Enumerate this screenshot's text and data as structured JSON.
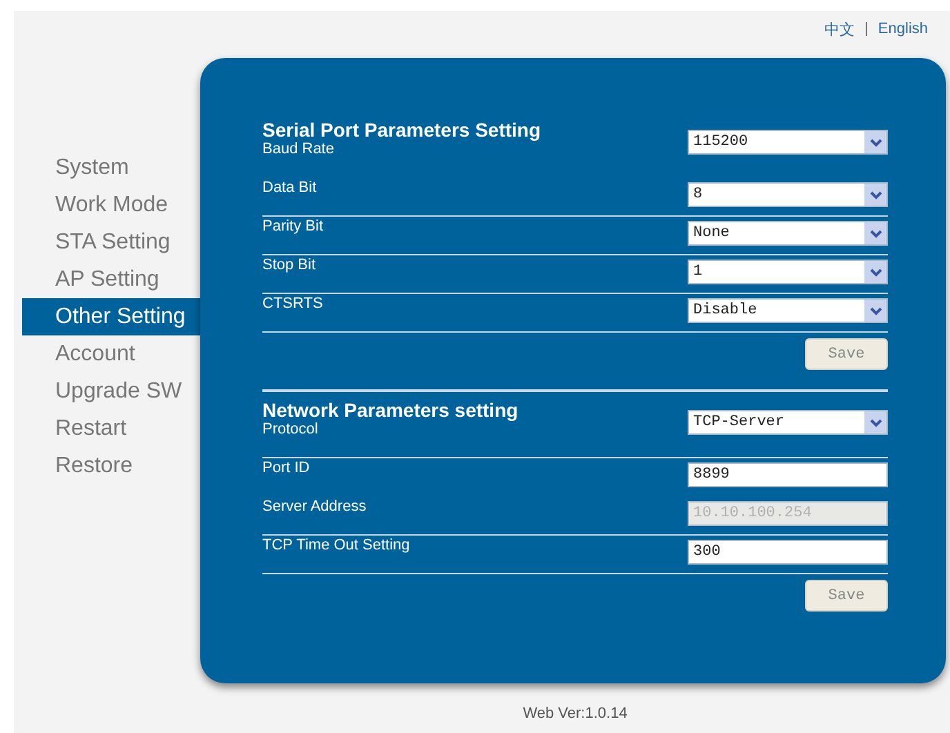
{
  "language_links": [
    "中文",
    "English"
  ],
  "sidebar": {
    "items": [
      {
        "label": "System",
        "selected": false
      },
      {
        "label": "Work Mode",
        "selected": false
      },
      {
        "label": "STA Setting",
        "selected": false
      },
      {
        "label": "AP Setting",
        "selected": false
      },
      {
        "label": "Other Setting",
        "selected": true
      },
      {
        "label": "Account",
        "selected": false
      },
      {
        "label": "Upgrade SW",
        "selected": false
      },
      {
        "label": "Restart",
        "selected": false
      },
      {
        "label": "Restore",
        "selected": false
      }
    ]
  },
  "sections": [
    {
      "title": "Serial Port Parameters Setting",
      "rule_above": false,
      "button": "Save",
      "rows": [
        {
          "label": "Baud Rate",
          "kind": "select",
          "value": "115200",
          "rule_below": false
        },
        {
          "label": "Data Bit",
          "kind": "select",
          "value": "8",
          "rule_below": true
        },
        {
          "label": "Parity Bit",
          "kind": "select",
          "value": "None",
          "rule_below": true
        },
        {
          "label": "Stop Bit",
          "kind": "select",
          "value": "1",
          "rule_below": true
        },
        {
          "label": "CTSRTS",
          "kind": "select",
          "value": "Disable",
          "rule_below": true
        }
      ]
    },
    {
      "title": "Network Parameters setting",
      "rule_above": true,
      "button": "Save",
      "rows": [
        {
          "label": "Protocol",
          "kind": "select",
          "value": "TCP-Server",
          "rule_below": true
        },
        {
          "label": "Port ID",
          "kind": "input",
          "value": "8899",
          "disabled": false,
          "rule_below": false
        },
        {
          "label": "Server Address",
          "kind": "input",
          "value": "10.10.100.254",
          "disabled": true,
          "rule_below": true
        },
        {
          "label": "TCP Time Out Setting",
          "kind": "input",
          "value": "300",
          "disabled": false,
          "rule_below": true
        }
      ]
    }
  ],
  "footer": "Web Ver:1.0.14"
}
